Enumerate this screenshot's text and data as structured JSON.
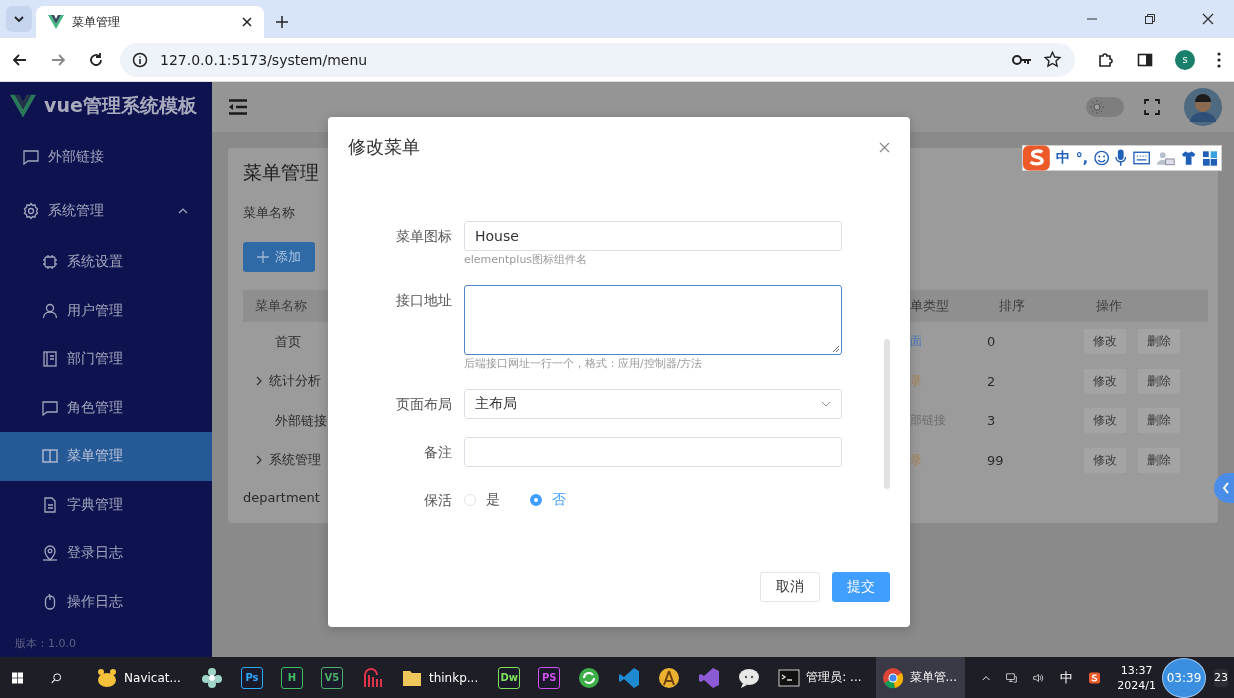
{
  "browser": {
    "tab_title": "菜单管理",
    "url": "127.0.0.1:5173/system/menu",
    "profile": "s"
  },
  "sidebar": {
    "logo": "vue管理系统模板",
    "items": [
      {
        "label": "外部链接",
        "selected": false
      },
      {
        "label": "系统管理",
        "selected": false,
        "expanded": true,
        "children": [
          {
            "label": "系统设置",
            "selected": false
          },
          {
            "label": "用户管理",
            "selected": false
          },
          {
            "label": "部门管理",
            "selected": false
          },
          {
            "label": "角色管理",
            "selected": false
          },
          {
            "label": "菜单管理",
            "selected": true
          },
          {
            "label": "字典管理",
            "selected": false
          },
          {
            "label": "登录日志",
            "selected": false
          },
          {
            "label": "操作日志",
            "selected": false
          }
        ]
      }
    ],
    "version": "版本：1.0.0"
  },
  "theme_switch": {
    "on": false
  },
  "ime_toolbar": {
    "mode": "中",
    "punctuation": "°,"
  },
  "page": {
    "title": "菜单管理",
    "search_label": "菜单名称",
    "add_button": "添加",
    "table": {
      "columns": [
        "菜单名称",
        "单类型",
        "排序",
        "操作"
      ],
      "rows": [
        {
          "name": "首页",
          "expandable": false,
          "type": "面",
          "color": "#4a78b8",
          "sort": "0",
          "actions": [
            "修改",
            "删除"
          ]
        },
        {
          "name": "统计分析",
          "expandable": true,
          "type": "录",
          "color": "#a88250",
          "sort": "2",
          "actions": [
            "修改",
            "删除"
          ]
        },
        {
          "name": "外部链接",
          "expandable": false,
          "type": "部链接",
          "color": "#6e6e6e",
          "sort": "3",
          "actions": [
            "修改",
            "删除"
          ]
        },
        {
          "name": "系统管理",
          "expandable": true,
          "type": "录",
          "color": "#a88250",
          "sort": "99",
          "actions": [
            "修改",
            "删除"
          ]
        }
      ]
    },
    "footer_text": "department"
  },
  "dialog": {
    "title": "修改菜单",
    "fields": [
      {
        "kind": "input",
        "label": "菜单图标",
        "value": "House",
        "help": "elementplus图标组件名"
      },
      {
        "kind": "textarea",
        "label": "接口地址",
        "focused": true,
        "help": "后端接口网址一行一个，格式：应用/控制器/方法"
      },
      {
        "kind": "select",
        "label": "页面布局",
        "value": "主布局"
      },
      {
        "kind": "input",
        "label": "备注"
      },
      {
        "kind": "radio",
        "label": "保活",
        "options": [
          {
            "label": "是",
            "selected": false
          },
          {
            "label": "否",
            "selected": true
          }
        ]
      }
    ],
    "buttons": [
      {
        "label": "取消",
        "kind": "default"
      },
      {
        "label": "提交",
        "kind": "primary"
      }
    ]
  },
  "taskbar": {
    "apps": [
      {
        "label": "Navicat...",
        "selected": false
      },
      {
        "selected": false
      },
      {
        "text": "Ps",
        "color": "#31a8ff",
        "selected": false
      },
      {
        "text": "H",
        "color": "#3fbf5f",
        "selected": false
      },
      {
        "text": "V5",
        "color": "#4caf6a",
        "selected": false
      },
      {
        "selected": false
      },
      {
        "label": "thinkp...",
        "selected": false
      },
      {
        "text": "Dw",
        "color": "#7fe05a",
        "selected": false
      },
      {
        "text": "PS",
        "color": "#d050f0",
        "selected": false
      },
      {
        "selected": false
      },
      {
        "selected": false
      },
      {
        "selected": false
      },
      {
        "selected": false
      },
      {
        "selected": false
      },
      {
        "label": "管理员: ...",
        "selected": false
      },
      {
        "label": "菜单管...",
        "selected": true
      }
    ],
    "ime": "中",
    "time": "13:37",
    "date": "2024/1",
    "timer": "03:39",
    "notifications": "23"
  }
}
